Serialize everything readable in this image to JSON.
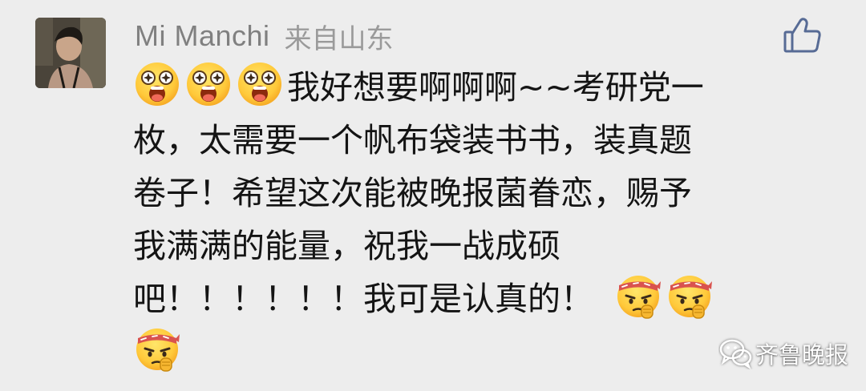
{
  "comment": {
    "username": "Mi Manchi",
    "location": "来自山东",
    "avatar": "user-avatar-photo",
    "like_icon": "thumbs-up-icon",
    "lines": [
      {
        "emojis_before": [
          "star-struck-face-emoji",
          "star-struck-face-emoji",
          "star-struck-face-emoji"
        ],
        "text": "我好想要啊啊啊~~考研党一"
      },
      {
        "text": "枚，太需要一个帆布袋装书书，装真题"
      },
      {
        "text": "卷子！希望这次能被晚报菌眷恋，赐予"
      },
      {
        "text": "我满满的能量，祝我一战成硕"
      },
      {
        "text": "吧！！！！！！我可是认真的！",
        "emojis_after": [
          "determined-face-emoji",
          "determined-face-emoji"
        ]
      },
      {
        "emojis_before": [
          "determined-face-emoji"
        ],
        "text": ""
      }
    ]
  },
  "watermark": {
    "icon": "wechat-icon",
    "text": "齐鲁晚报"
  },
  "colors": {
    "background": "#ededed",
    "username": "#808080",
    "body_text": "#141414",
    "like_icon": "#576b95"
  }
}
